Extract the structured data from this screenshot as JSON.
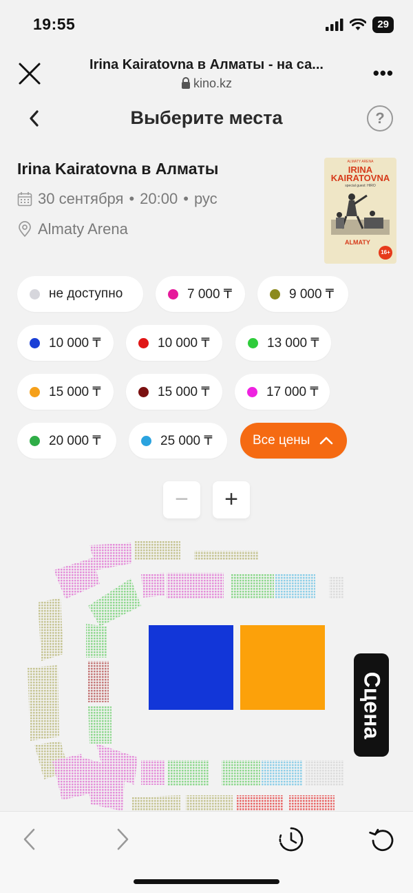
{
  "status": {
    "time": "19:55",
    "battery": "29"
  },
  "browser": {
    "title": "Irina Kairatovna в Алматы - на са...",
    "url": "kino.kz",
    "more": "•••"
  },
  "page": {
    "title": "Выберите места",
    "help": "?"
  },
  "event": {
    "title": "Irina Kairatovna в Алматы",
    "date": "30 сентября",
    "time": "20:00",
    "language": "рус",
    "separator": "•",
    "venue": "Almaty Arena",
    "poster": {
      "brand": "ALMATY ARENA",
      "artist": "IRINA KAIRATOVNA",
      "guest": "special guest: HIRO",
      "city": "ALMATY",
      "age": "16+"
    }
  },
  "prices": [
    {
      "label": "не доступно",
      "color": "#d6d6dc"
    },
    {
      "label": "7 000 ₸",
      "color": "#e6199b"
    },
    {
      "label": "9 000 ₸",
      "color": "#8c8a1e"
    },
    {
      "label": "10 000 ₸",
      "color": "#1a3fd6"
    },
    {
      "label": "10 000 ₸",
      "color": "#e01515"
    },
    {
      "label": "13 000 ₸",
      "color": "#2ecc3b"
    },
    {
      "label": "15 000 ₸",
      "color": "#f5a01a"
    },
    {
      "label": "15 000 ₸",
      "color": "#7a1010"
    },
    {
      "label": "17 000 ₸",
      "color": "#ee22e0"
    },
    {
      "label": "20 000 ₸",
      "color": "#2fad47"
    },
    {
      "label": "25 000 ₸",
      "color": "#2ba3df"
    }
  ],
  "all_prices_label": "Все цены",
  "zoom": {
    "minus": "−",
    "plus": "+"
  },
  "seatmap": {
    "stage_label": "Сцена",
    "colors": {
      "olive": "#c7c595",
      "pink": "#e48fd9",
      "green": "#8fd88f",
      "cyan": "#8fcfe8",
      "maroon": "#c57a7a",
      "red": "#e86a6a",
      "blue": "#1236d8",
      "orange": "#fca10a"
    }
  }
}
